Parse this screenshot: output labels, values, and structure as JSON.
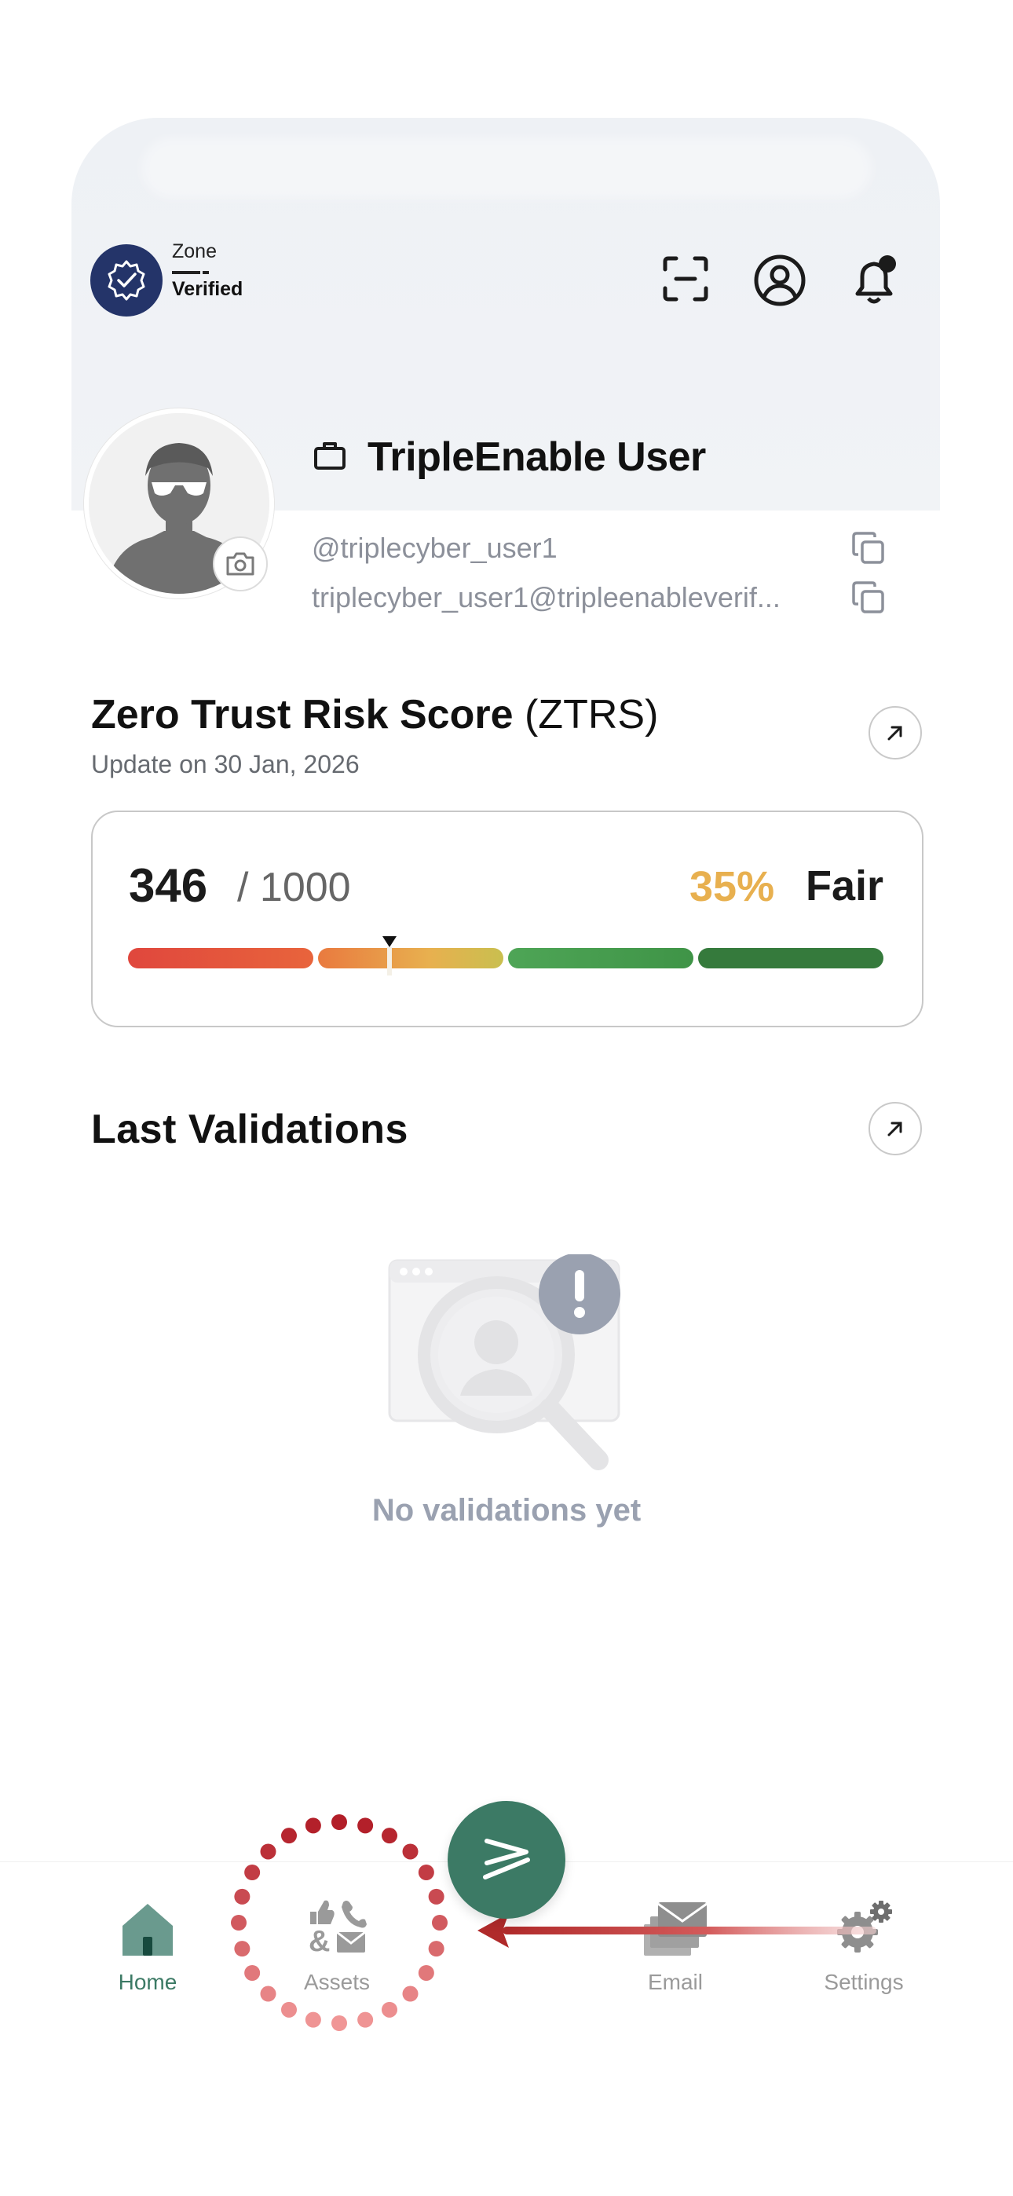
{
  "header": {
    "zone_label": "Zone",
    "zone_status": "Verified",
    "icons": [
      "scan-icon",
      "account-icon",
      "bell-icon"
    ]
  },
  "profile": {
    "name": "TripleEnable User",
    "handle": "@triplecyber_user1",
    "email": "triplecyber_user1@tripleenableverif..."
  },
  "ztrs": {
    "title_bold": "Zero Trust Risk Score",
    "title_abbr": "(ZTRS)",
    "updated": "Update on 30 Jan, 2026",
    "score": "346",
    "max": "/ 1000",
    "percent": "35%",
    "level": "Fair",
    "percent_value": 0.346,
    "colors": {
      "poor": "#e0473d",
      "fair": "#e8b04f",
      "good": "#4ea556",
      "excellent": "#357a3c",
      "percent_text": "#e8b04f"
    }
  },
  "validations": {
    "title": "Last Validations",
    "empty_text": "No validations yet"
  },
  "nav": {
    "home": "Home",
    "assets": "Assets",
    "email": "Email",
    "settings": "Settings",
    "active": "home",
    "active_color": "#3c7a65"
  }
}
